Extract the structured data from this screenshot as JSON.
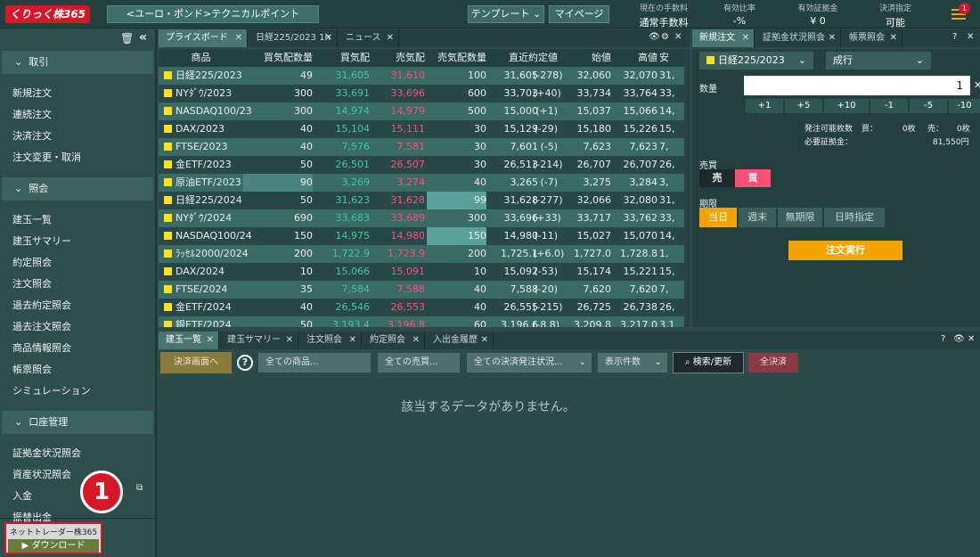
{
  "header": {
    "logo": "くりっく株365",
    "title": "<ユーロ・ポンド>テクニカルポイント",
    "template": "テンプレート",
    "mypage": "マイページ",
    "stats": [
      {
        "label": "現在の手数料",
        "value": "通常手数料"
      },
      {
        "label": "有効比率",
        "value": "-%"
      },
      {
        "label": "有効証拠金",
        "value": "¥ 0"
      },
      {
        "label": "決済指定",
        "value": "可能"
      }
    ],
    "notice_count": "1"
  },
  "sidebar": {
    "sections": [
      {
        "label": "取引",
        "items": [
          "新規注文",
          "連続注文",
          "決済注文",
          "注文変更・取消"
        ]
      },
      {
        "label": "照会",
        "items": [
          "建玉一覧",
          "建玉サマリー",
          "約定照会",
          "注文照会",
          "過去約定照会",
          "過去注文照会",
          "商品情報照会",
          "帳票照会",
          "シミュレーション"
        ]
      },
      {
        "label": "口座管理",
        "items": [
          "証拠金状況照会",
          "資産状況照会",
          "入金",
          "振替出金"
        ]
      }
    ],
    "callout": "1",
    "download_title": "ネットトレーダー株365",
    "download_label": "ダウンロード"
  },
  "price_tabs": [
    "プライスボード",
    "日経225/2023 1h",
    "ニュース"
  ],
  "price_board": {
    "columns": [
      "商品",
      "買気配数量",
      "買気配",
      "売気配",
      "売気配数量",
      "直近約定値",
      "始値",
      "高値",
      "安"
    ],
    "rows": [
      [
        "日経225/2023",
        "49",
        "31,605",
        "31,610",
        "100",
        "31,605",
        "(-278)",
        "32,060",
        "32,070",
        "31,"
      ],
      [
        "NYﾀﾞｳ/2023",
        "300",
        "33,691",
        "33,696",
        "600",
        "33,703",
        "(+40)",
        "33,734",
        "33,764",
        "33,"
      ],
      [
        "NASDAQ100/23",
        "300",
        "14,974",
        "14,979",
        "500",
        "15,000",
        "(+1)",
        "15,037",
        "15,066",
        "14,"
      ],
      [
        "DAX/2023",
        "40",
        "15,104",
        "15,111",
        "30",
        "15,129",
        "(-29)",
        "15,180",
        "15,226",
        "15,"
      ],
      [
        "FTSE/2023",
        "40",
        "7,576",
        "7,581",
        "30",
        "7,601",
        "(-5)",
        "7,623",
        "7,623",
        "7,"
      ],
      [
        "金ETF/2023",
        "50",
        "26,501",
        "26,507",
        "30",
        "26,513",
        "(-214)",
        "26,707",
        "26,707",
        "26,"
      ],
      [
        "原油ETF/2023",
        "90",
        "3,269",
        "3,274",
        "40",
        "3,265",
        "(-7)",
        "3,275",
        "3,284",
        "3,"
      ],
      [
        "日経225/2024",
        "50",
        "31,623",
        "31,628",
        "99",
        "31,628",
        "(-277)",
        "32,066",
        "32,080",
        "31,"
      ],
      [
        "NYﾀﾞｳ/2024",
        "690",
        "33,683",
        "33,689",
        "300",
        "33,696",
        "(+33)",
        "33,717",
        "33,762",
        "33,"
      ],
      [
        "NASDAQ100/24",
        "150",
        "14,975",
        "14,980",
        "150",
        "14,980",
        "(-11)",
        "15,027",
        "15,070",
        "14,"
      ],
      [
        "ﾗｯｾﾙ2000/2024",
        "200",
        "1,722.9",
        "1,723.9",
        "200",
        "1,725.1",
        "(+6.0)",
        "1,727.0",
        "1,728.8",
        "1,"
      ],
      [
        "DAX/2024",
        "10",
        "15,066",
        "15,091",
        "10",
        "15,092",
        "(-53)",
        "15,174",
        "15,221",
        "15,"
      ],
      [
        "FTSE/2024",
        "35",
        "7,584",
        "7,588",
        "40",
        "7,588",
        "(-20)",
        "7,620",
        "7,620",
        "7,"
      ],
      [
        "金ETF/2024",
        "40",
        "26,546",
        "26,553",
        "40",
        "26,555",
        "(-215)",
        "26,725",
        "26,738",
        "26,"
      ],
      [
        "銀ETF/2024",
        "50",
        "3,193.4",
        "3,196.8",
        "60",
        "3,196.6",
        "(-8.8)",
        "3,209.8",
        "3,217.0",
        "3,1"
      ]
    ]
  },
  "order_tabs": [
    "新規注文",
    "証拠金状況照会",
    "帳票照会"
  ],
  "order": {
    "product": "日経225/2023",
    "type": "成行",
    "qty_label": "数量",
    "qty": "1",
    "steps": [
      "+1",
      "+5",
      "+10",
      "-1",
      "-5",
      "-10"
    ],
    "avail_label": "発注可能枚数",
    "buy": "買：",
    "buy_val": "0枚",
    "sell": "売：",
    "sell_val": "0枚",
    "margin_label": "必要証拠金：",
    "margin_val": "81,550円",
    "side_label": "売買",
    "sell_btn": "売",
    "buy_btn": "買",
    "term_label": "期限",
    "terms": [
      "当日",
      "週末",
      "無期限",
      "日時指定"
    ],
    "submit": "注文実行"
  },
  "bottom_tabs": [
    "建玉一覧",
    "建玉サマリー",
    "注文照会",
    "約定照会",
    "入出金履歴"
  ],
  "bottom": {
    "settle": "決済画面へ",
    "help": "?",
    "products": "全ての商品...",
    "sides": "全ての売買...",
    "status": "全ての決済発注状況...",
    "count": "表示件数",
    "search": "検索/更新",
    "all_settle": "全決済",
    "empty": "該当するデータがありません。"
  },
  "colors": {
    "buy": "#3ec9a8",
    "sell": "#ff4f77",
    "accent": "#f5a300"
  }
}
